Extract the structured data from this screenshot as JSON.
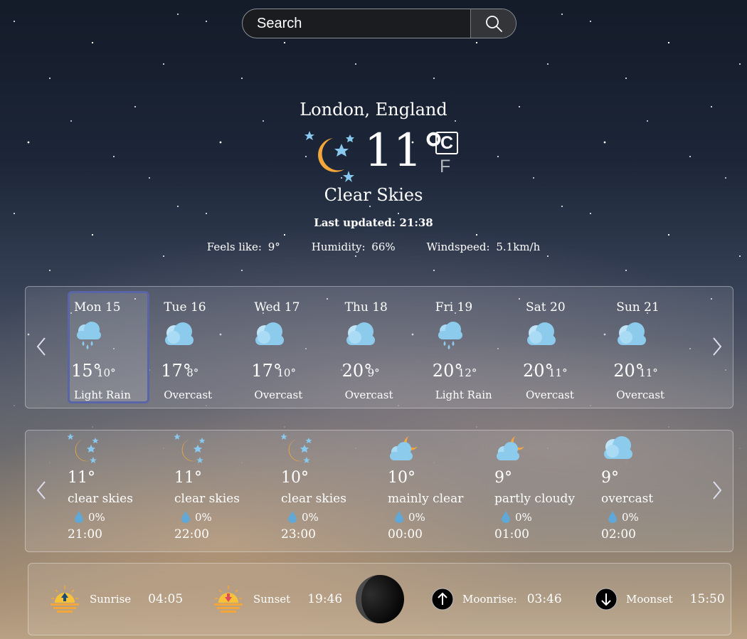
{
  "search": {
    "placeholder": "Search",
    "icon": "search-icon"
  },
  "current": {
    "location": "London, England",
    "icon": "moon-stars-icon",
    "temperature": "11°",
    "unit_active": "C",
    "unit_inactive": "F",
    "condition": "Clear Skies",
    "updated_label": "Last updated: 21:38",
    "stats": [
      {
        "label": "Feels like:",
        "value": "9°"
      },
      {
        "label": "Humidity:",
        "value": "66%"
      },
      {
        "label": "Windspeed:",
        "value": "5.1km/h"
      }
    ]
  },
  "daily": [
    {
      "day": "Mon 15",
      "icon": "rain-cloud-icon",
      "hi": "15°",
      "lo": "10°",
      "desc": "Light Rain",
      "selected": true
    },
    {
      "day": "Tue 16",
      "icon": "cloud-icon",
      "hi": "17°",
      "lo": "8°",
      "desc": "Overcast"
    },
    {
      "day": "Wed 17",
      "icon": "cloud-icon",
      "hi": "17°",
      "lo": "10°",
      "desc": "Overcast"
    },
    {
      "day": "Thu 18",
      "icon": "cloud-icon",
      "hi": "20°",
      "lo": "9°",
      "desc": "Overcast"
    },
    {
      "day": "Fri 19",
      "icon": "rain-cloud-icon",
      "hi": "20°",
      "lo": "12°",
      "desc": "Light Rain"
    },
    {
      "day": "Sat 20",
      "icon": "cloud-icon",
      "hi": "20°",
      "lo": "11°",
      "desc": "Overcast"
    },
    {
      "day": "Sun 21",
      "icon": "cloud-icon",
      "hi": "20°",
      "lo": "11°",
      "desc": "Overcast"
    }
  ],
  "hourly": [
    {
      "icon": "moon-stars-icon",
      "temp": "11°",
      "desc": "clear skies",
      "precip": "0%",
      "time": "21:00"
    },
    {
      "icon": "moon-stars-icon",
      "temp": "11°",
      "desc": "clear skies",
      "precip": "0%",
      "time": "22:00"
    },
    {
      "icon": "moon-stars-icon",
      "temp": "10°",
      "desc": "clear skies",
      "precip": "0%",
      "time": "23:00"
    },
    {
      "icon": "cloud-moon-icon",
      "temp": "10°",
      "desc": "mainly clear",
      "precip": "0%",
      "time": "00:00"
    },
    {
      "icon": "cloud-moon-icon",
      "temp": "9°",
      "desc": "partly cloudy",
      "precip": "0%",
      "time": "01:00"
    },
    {
      "icon": "cloud-icon",
      "temp": "9°",
      "desc": "overcast",
      "precip": "0%",
      "time": "02:00"
    }
  ],
  "astro": {
    "sunrise_label": "Sunrise",
    "sunrise": "04:05",
    "sunset_label": "Sunset",
    "sunset": "19:46",
    "moonrise_label": "Moonrise:",
    "moonrise": "03:46",
    "moonset_label": "Moonset",
    "moonset": "15:50",
    "moon_phase_icon": "moon-phase-icon"
  },
  "colors": {
    "accent": "#5a65a8",
    "sun": "#f3a73b",
    "cloud": "#8ccbec",
    "star": "#89c9ef"
  }
}
